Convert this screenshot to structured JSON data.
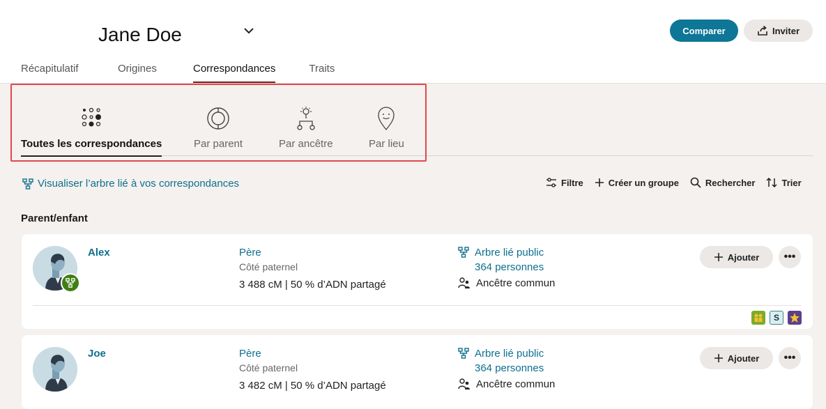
{
  "header": {
    "profile_name": "Jane Doe",
    "compare_label": "Comparer",
    "invite_label": "Inviter",
    "tabs": [
      {
        "label": "Récapitulatif"
      },
      {
        "label": "Origines"
      },
      {
        "label": "Correspondances",
        "active": true
      },
      {
        "label": "Traits"
      }
    ]
  },
  "subnav": {
    "items": [
      {
        "label": "Toutes les correspondances",
        "icon": "dots-cluster-icon",
        "active": true
      },
      {
        "label": "Par parent",
        "icon": "ring-icon"
      },
      {
        "label": "Par ancêtre",
        "icon": "ancestor-tree-icon"
      },
      {
        "label": "Par lieu",
        "icon": "map-pin-icon"
      }
    ]
  },
  "toolbar": {
    "tree_link": "Visualiser l’arbre lié à vos correspondances",
    "filter": "Filtre",
    "create_group": "Créer un groupe",
    "search": "Rechercher",
    "sort": "Trier"
  },
  "section_title": "Parent/enfant",
  "matches": [
    {
      "name": "Alex",
      "relationship": "Père",
      "side": "Côté paternel",
      "dna": "3 488 cM | 50 % d’ADN partagé",
      "tree_label": "Arbre lié public",
      "tree_count": "364 personnes",
      "common_ancestor": "Ancêtre commun",
      "add_label": "Ajouter",
      "more_label": "•••",
      "tag_s": "S"
    },
    {
      "name": "Joe",
      "relationship": "Père",
      "side": "Côté paternel",
      "dna": "3 482 cM | 50 % d’ADN partagé",
      "tree_label": "Arbre lié public",
      "tree_count": "364 personnes",
      "common_ancestor": "Ancêtre commun",
      "add_label": "Ajouter",
      "more_label": "•••"
    }
  ],
  "colors": {
    "accent": "#0e7697",
    "link": "#0e6f8f",
    "highlight_box": "#e0484d",
    "tree_badge": "#3f7f15"
  }
}
